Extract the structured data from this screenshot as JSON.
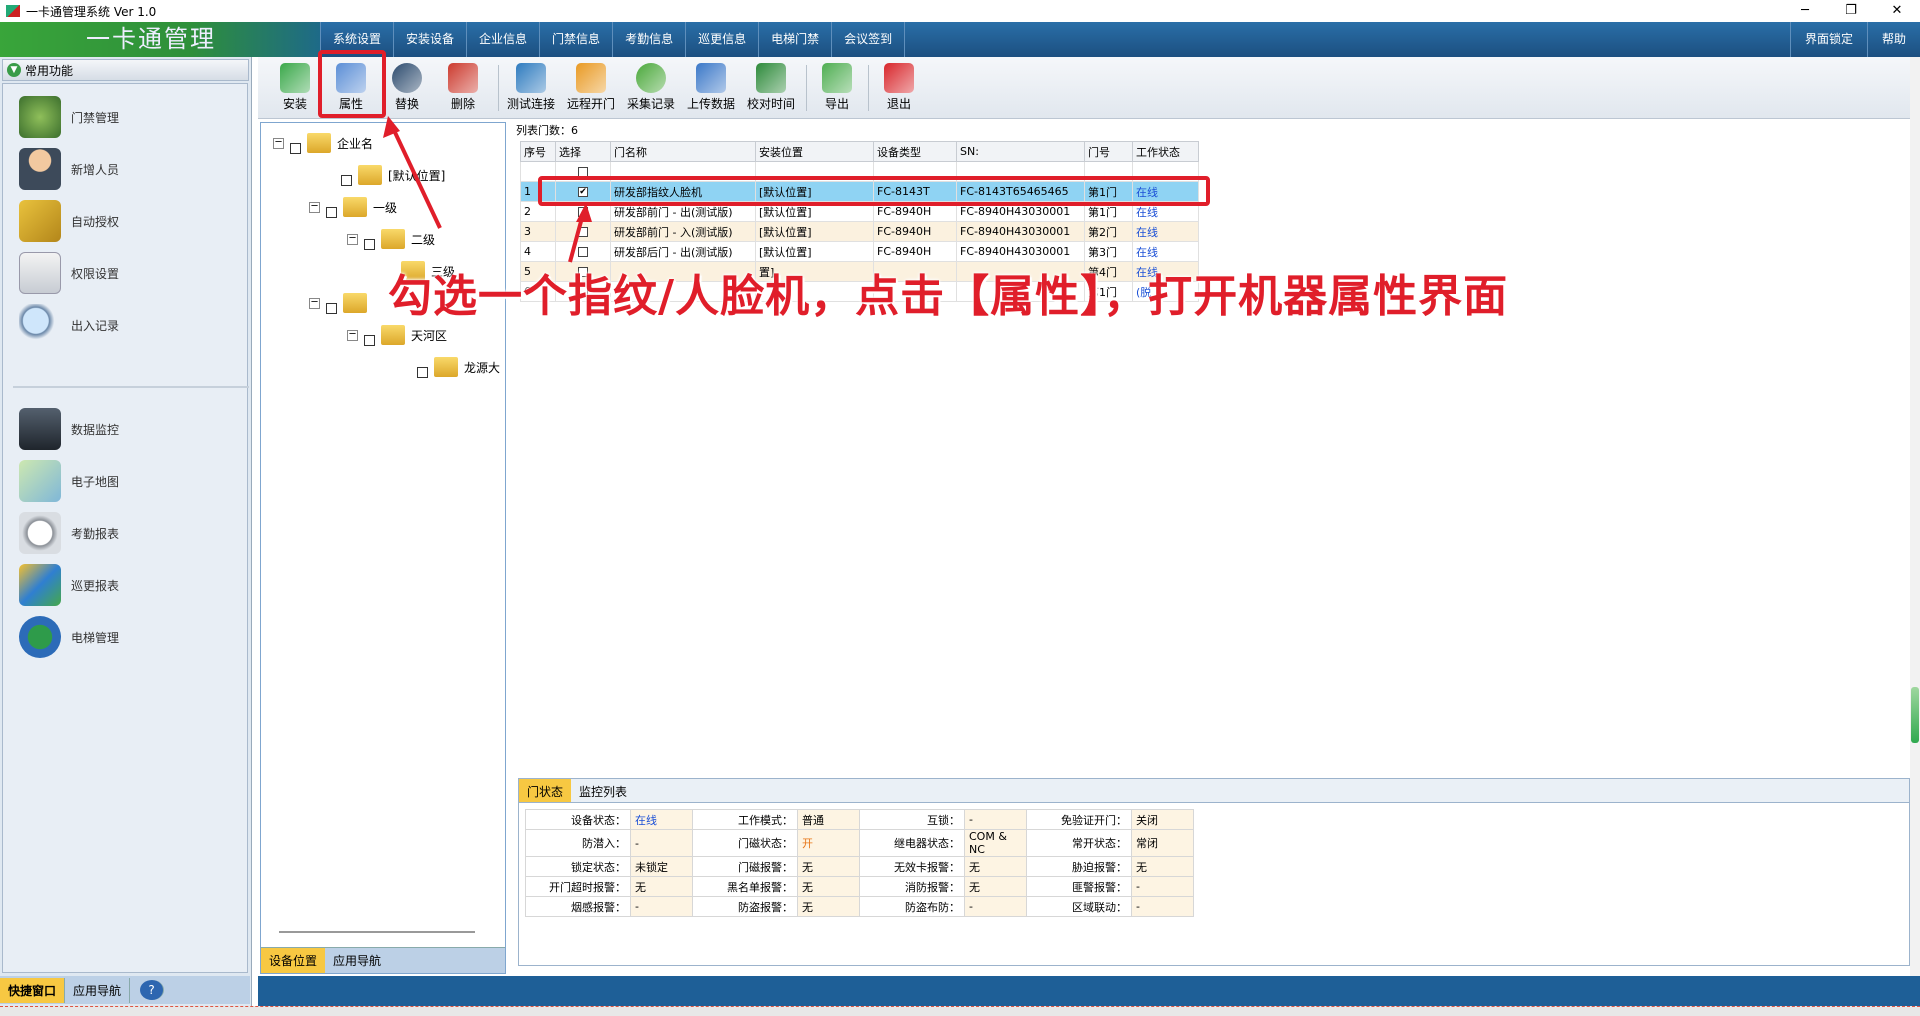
{
  "window": {
    "title": "一卡通管理系统  Ver 1.0",
    "controls": [
      "─",
      "❐",
      "✕"
    ]
  },
  "brand": "一卡通管理",
  "menu": [
    "系统设置",
    "安装设备",
    "企业信息",
    "门禁信息",
    "考勤信息",
    "巡更信息",
    "电梯门禁",
    "会议签到"
  ],
  "menu_right": [
    "界面锁定",
    "帮助"
  ],
  "sidebar": {
    "header": "常用功能",
    "items": [
      {
        "label": "门禁管理",
        "icon": "door-control-icon"
      },
      {
        "label": "新增人员",
        "icon": "person-icon"
      },
      {
        "label": "自动授权",
        "icon": "card-icon"
      },
      {
        "label": "权限设置",
        "icon": "permission-icon"
      },
      {
        "label": "出入记录",
        "icon": "magnifier-icon"
      },
      {
        "label": "数据监控",
        "icon": "camera-icon"
      },
      {
        "label": "电子地图",
        "icon": "map-icon"
      },
      {
        "label": "考勤报表",
        "icon": "clock-icon"
      },
      {
        "label": "巡更报表",
        "icon": "patrol-icon"
      },
      {
        "label": "电梯管理",
        "icon": "elevator-icon"
      }
    ],
    "tabs": [
      "快捷窗口",
      "应用导航"
    ],
    "help": "?"
  },
  "toolbar": [
    {
      "label": "安装",
      "icon": "install-icon",
      "color": "#3aa84a"
    },
    {
      "label": "属性",
      "icon": "properties-icon",
      "color": "#5b8ed6"
    },
    {
      "label": "替换",
      "icon": "replace-icon",
      "color": "#2c4b6e"
    },
    {
      "label": "删除",
      "icon": "delete-icon",
      "color": "#cc3a2e"
    },
    {
      "label": "测试连接",
      "icon": "test-connection-icon",
      "color": "#2e7bbf"
    },
    {
      "label": "远程开门",
      "icon": "remote-open-icon",
      "color": "#e99a23"
    },
    {
      "label": "采集记录",
      "icon": "collect-records-icon",
      "color": "#4aa83a"
    },
    {
      "label": "上传数据",
      "icon": "upload-icon",
      "color": "#3b78c8"
    },
    {
      "label": "校对时间",
      "icon": "calendar-icon",
      "color": "#2d8a3a"
    },
    {
      "label": "导出",
      "icon": "export-icon",
      "color": "#4fae52"
    },
    {
      "label": "退出",
      "icon": "exit-icon",
      "color": "#d8262b"
    }
  ],
  "tree": {
    "nodes": [
      {
        "label": "企业名",
        "exp": "─"
      },
      {
        "label": "[默认位置]",
        "exp": ""
      },
      {
        "label": "一级",
        "exp": "─"
      },
      {
        "label": "二级",
        "exp": "─"
      },
      {
        "label": "三级",
        "exp": ""
      },
      {
        "label": "",
        "exp": "─"
      },
      {
        "label": "天河区",
        "exp": "─"
      },
      {
        "label": "龙源大",
        "exp": ""
      }
    ],
    "tabs": [
      "设备位置",
      "应用导航"
    ]
  },
  "grid": {
    "count_label": "列表门数：6",
    "columns": [
      "序号",
      "选择",
      "门名称",
      "安装位置",
      "设备类型",
      "SN:",
      "门号",
      "工作状态"
    ],
    "rows": [
      {
        "no": "",
        "checked": false,
        "name": "",
        "location": "",
        "type": "",
        "sn": "",
        "door": "",
        "status": ""
      },
      {
        "no": "1",
        "checked": true,
        "name": "研发部指纹人脸机",
        "location": "[默认位置]",
        "type": "FC-8143T",
        "sn": "FC-8143T65465465",
        "door": "第1门",
        "status": "在线"
      },
      {
        "no": "2",
        "checked": false,
        "name": "研发部前门 - 出(测试版)",
        "location": "[默认位置]",
        "type": "FC-8940H",
        "sn": "FC-8940H43030001",
        "door": "第1门",
        "status": "在线"
      },
      {
        "no": "3",
        "checked": false,
        "name": "研发部前门 - 入(测试版)",
        "location": "[默认位置]",
        "type": "FC-8940H",
        "sn": "FC-8940H43030001",
        "door": "第2门",
        "status": "在线"
      },
      {
        "no": "4",
        "checked": false,
        "name": "研发部后门 - 出(测试版)",
        "location": "[默认位置]",
        "type": "FC-8940H",
        "sn": "FC-8940H43030001",
        "door": "第3门",
        "status": "在线"
      },
      {
        "no": "5",
        "checked": false,
        "name": "",
        "location": "置]",
        "type": "",
        "sn": "",
        "door": "第4门",
        "status": "在线"
      },
      {
        "no": "6",
        "checked": false,
        "name": "",
        "location": "",
        "type": "",
        "sn": "",
        "door": "第1门",
        "status": "(脱"
      }
    ]
  },
  "status_panel": {
    "tabs": [
      "门状态",
      "监控列表"
    ],
    "rows": [
      [
        [
          "设备状态：",
          "在线"
        ],
        [
          "工作模式：",
          "普通"
        ],
        [
          "互锁：",
          "-"
        ],
        [
          "免验证开门：",
          "关闭"
        ]
      ],
      [
        [
          "防潜入：",
          "-"
        ],
        [
          "门磁状态：",
          "开"
        ],
        [
          "继电器状态：",
          "COM & NC"
        ],
        [
          "常开状态：",
          "常闭"
        ]
      ],
      [
        [
          "锁定状态：",
          "未锁定"
        ],
        [
          "门磁报警：",
          "无"
        ],
        [
          "无效卡报警：",
          "无"
        ],
        [
          "胁迫报警：",
          "无"
        ]
      ],
      [
        [
          "开门超时报警：",
          "无"
        ],
        [
          "黑名单报警：",
          "无"
        ],
        [
          "消防报警：",
          "无"
        ],
        [
          "匪警报警：",
          "-"
        ]
      ],
      [
        [
          "烟感报警：",
          "-"
        ],
        [
          "防盗报警：",
          "无"
        ],
        [
          "防盗布防：",
          "-"
        ],
        [
          "区域联动：",
          "-"
        ]
      ]
    ]
  },
  "annotation": {
    "text": "勾选一个指纹/人脸机，点击【属性】，打开机器属性界面",
    "color": "#e01e2a"
  }
}
